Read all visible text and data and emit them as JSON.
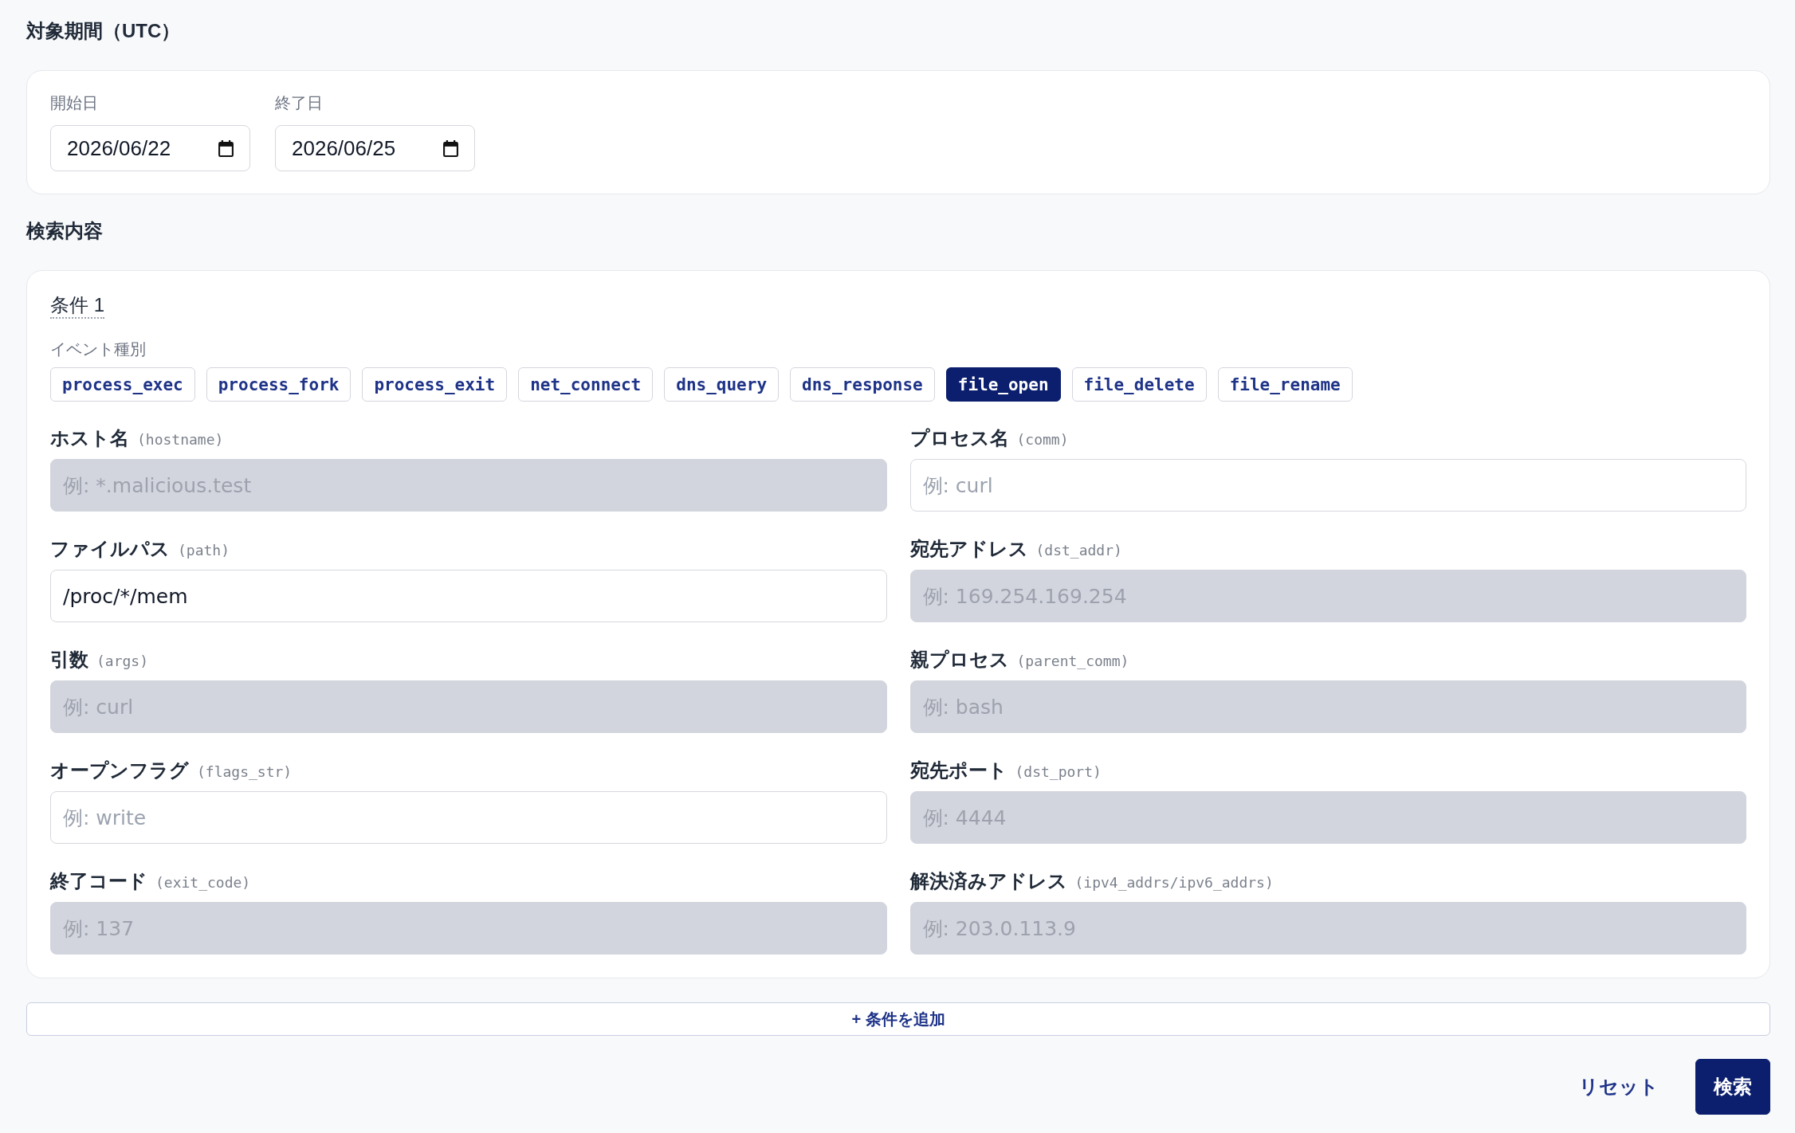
{
  "period": {
    "heading": "対象期間（UTC）",
    "fields": [
      {
        "label": "開始日",
        "value": "2026/06/22"
      },
      {
        "label": "終了日",
        "value": "2026/06/25"
      }
    ]
  },
  "search": {
    "heading": "検索内容",
    "conditions": [
      {
        "title": "条件 1",
        "event_label": "イベント種別",
        "event_types": [
          {
            "label": "process_exec",
            "selected": false
          },
          {
            "label": "process_fork",
            "selected": false
          },
          {
            "label": "process_exit",
            "selected": false
          },
          {
            "label": "net_connect",
            "selected": false
          },
          {
            "label": "dns_query",
            "selected": false
          },
          {
            "label": "dns_response",
            "selected": false
          },
          {
            "label": "file_open",
            "selected": true
          },
          {
            "label": "file_delete",
            "selected": false
          },
          {
            "label": "file_rename",
            "selected": false
          }
        ],
        "fields": [
          {
            "label": "ホスト名",
            "hint": "(hostname)",
            "placeholder": "例: *.malicious.test",
            "disabled": true
          },
          {
            "label": "プロセス名",
            "hint": "(comm)",
            "placeholder": "例: curl",
            "disabled": false
          },
          {
            "label": "ファイルパス",
            "hint": "(path)",
            "value": "/proc/*/mem",
            "disabled": false
          },
          {
            "label": "宛先アドレス",
            "hint": "(dst_addr)",
            "placeholder": "例: 169.254.169.254",
            "disabled": true
          },
          {
            "label": "引数",
            "hint": "(args)",
            "placeholder": "例: curl",
            "disabled": true
          },
          {
            "label": "親プロセス",
            "hint": "(parent_comm)",
            "placeholder": "例: bash",
            "disabled": true
          },
          {
            "label": "オープンフラグ",
            "hint": "(flags_str)",
            "placeholder": "例: write",
            "disabled": false
          },
          {
            "label": "宛先ポート",
            "hint": "(dst_port)",
            "placeholder": "例: 4444",
            "disabled": true
          },
          {
            "label": "終了コード",
            "hint": "(exit_code)",
            "placeholder": "例: 137",
            "disabled": true
          },
          {
            "label": "解決済みアドレス",
            "hint": "(ipv4_addrs/ipv6_addrs)",
            "placeholder": "例: 203.0.113.9",
            "disabled": true
          }
        ]
      }
    ],
    "add_button": "+ 条件を追加"
  },
  "actions": [
    {
      "label": "リセット",
      "kind": "text"
    },
    {
      "label": "検索",
      "kind": "primary"
    }
  ]
}
